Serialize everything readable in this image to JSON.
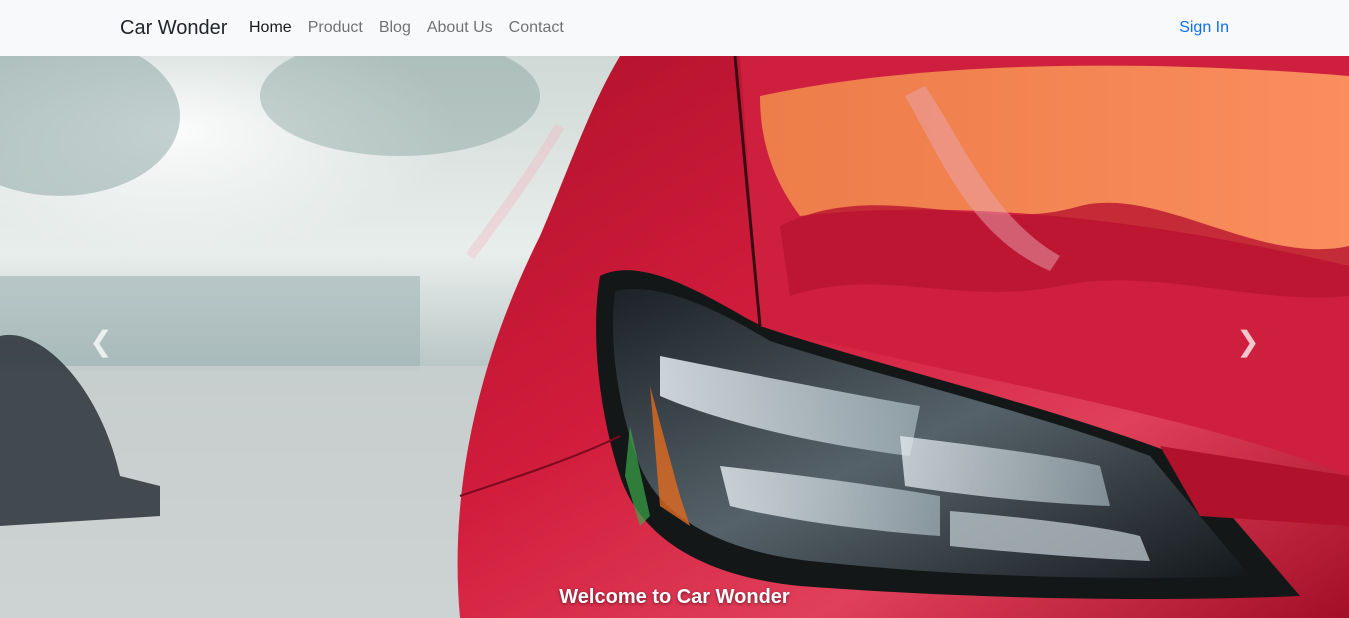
{
  "navbar": {
    "brand": "Car Wonder",
    "links": [
      {
        "label": "Home",
        "active": true
      },
      {
        "label": "Product",
        "active": false
      },
      {
        "label": "Blog",
        "active": false
      },
      {
        "label": "About Us",
        "active": false
      },
      {
        "label": "Contact",
        "active": false
      }
    ],
    "signin": "Sign In"
  },
  "carousel": {
    "prev_icon": "chevron-left-icon",
    "next_icon": "chevron-right-icon",
    "prev_glyph": "❮",
    "next_glyph": "❯",
    "caption": "Welcome to Car Wonder"
  },
  "colors": {
    "navbar_bg": "#f8f9fa",
    "link_primary": "#0d6efd",
    "car_red": "#c8102e"
  }
}
